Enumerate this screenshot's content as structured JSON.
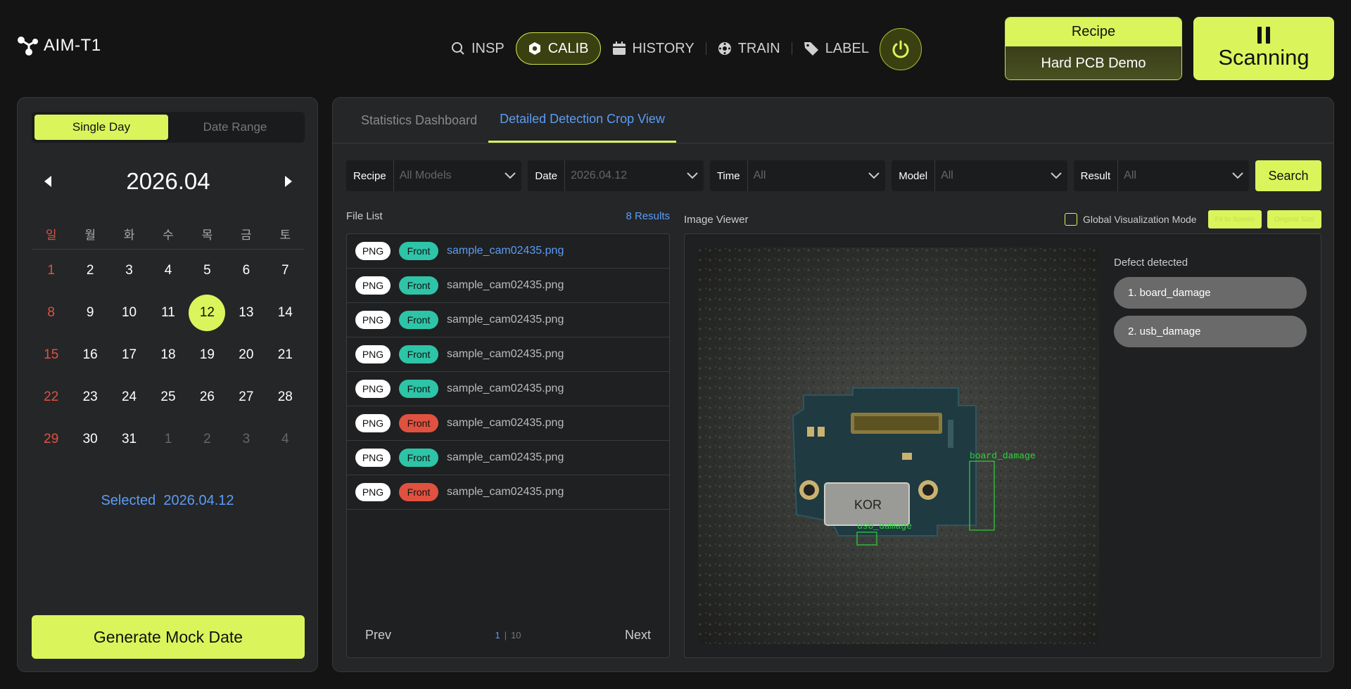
{
  "app": {
    "title": "AIM-T1"
  },
  "nav": {
    "items": [
      {
        "label": "INSP",
        "icon": "search-icon",
        "active": false
      },
      {
        "label": "CALIB",
        "icon": "hexagon-icon",
        "active": true
      },
      {
        "label": "HISTORY",
        "icon": "calendar-icon",
        "active": false
      },
      {
        "label": "TRAIN",
        "icon": "gear-icon",
        "active": false
      },
      {
        "label": "LABEL",
        "icon": "tag-icon",
        "active": false
      }
    ]
  },
  "recipe": {
    "label": "Recipe",
    "value": "Hard PCB Demo"
  },
  "scan": {
    "label": "Scanning",
    "icon": "pause-icon"
  },
  "calendar": {
    "mode_single": "Single Day",
    "mode_range": "Date Range",
    "month": "2026.04",
    "weekdays": [
      "일",
      "월",
      "화",
      "수",
      "목",
      "금",
      "토"
    ],
    "weeks": [
      [
        "1",
        "2",
        "3",
        "4",
        "5",
        "6",
        "7"
      ],
      [
        "8",
        "9",
        "10",
        "11",
        "12",
        "13",
        "14"
      ],
      [
        "15",
        "16",
        "17",
        "18",
        "19",
        "20",
        "21"
      ],
      [
        "22",
        "23",
        "24",
        "25",
        "26",
        "27",
        "28"
      ],
      [
        "29",
        "30",
        "31",
        "1",
        "2",
        "3",
        "4"
      ]
    ],
    "selected_label": "Selected",
    "selected_value": "2026.04.12",
    "generate_label": "Generate Mock Date"
  },
  "tabs": [
    {
      "label": "Statistics Dashboard",
      "active": false
    },
    {
      "label": "Detailed Detection Crop View",
      "active": true
    }
  ],
  "filters": {
    "recipe": {
      "label": "Recipe",
      "value": "All Models"
    },
    "date": {
      "label": "Date",
      "value": "2026.04.12"
    },
    "time": {
      "label": "Time",
      "value": "All"
    },
    "model": {
      "label": "Model",
      "value": "All"
    },
    "result": {
      "label": "Result",
      "value": "All"
    },
    "search_label": "Search"
  },
  "file_list": {
    "title": "File List",
    "count": "8 Results",
    "files": [
      {
        "type": "PNG",
        "side": "Front",
        "status": "ok",
        "name": "sample_cam02435.png"
      },
      {
        "type": "PNG",
        "side": "Front",
        "status": "ok",
        "name": "sample_cam02435.png"
      },
      {
        "type": "PNG",
        "side": "Front",
        "status": "ok",
        "name": "sample_cam02435.png"
      },
      {
        "type": "PNG",
        "side": "Front",
        "status": "ok",
        "name": "sample_cam02435.png"
      },
      {
        "type": "PNG",
        "side": "Front",
        "status": "ok",
        "name": "sample_cam02435.png"
      },
      {
        "type": "PNG",
        "side": "Front",
        "status": "ng",
        "name": "sample_cam02435.png"
      },
      {
        "type": "PNG",
        "side": "Front",
        "status": "ok",
        "name": "sample_cam02435.png"
      },
      {
        "type": "PNG",
        "side": "Front",
        "status": "ng",
        "name": "sample_cam02435.png"
      }
    ],
    "prev_label": "Prev",
    "next_label": "Next",
    "current_page": "1",
    "total_pages": "10"
  },
  "viewer": {
    "title": "Image Viewer",
    "global_viz_label": "Global Visualization Mode",
    "fit_label": "Fit to Screen",
    "original_label": "Original Size",
    "defect_title": "Defect detected",
    "defects": [
      "1. board_damage",
      "2. usb_damage"
    ],
    "box_labels": [
      "board_damage",
      "usb_damage"
    ],
    "board_text": "KOR"
  },
  "colors": {
    "accent": "#d9f55b",
    "link": "#5b9cf5",
    "ok": "#2ec4a7",
    "ng": "#e0523f",
    "detection_box": "#2fd33b"
  }
}
